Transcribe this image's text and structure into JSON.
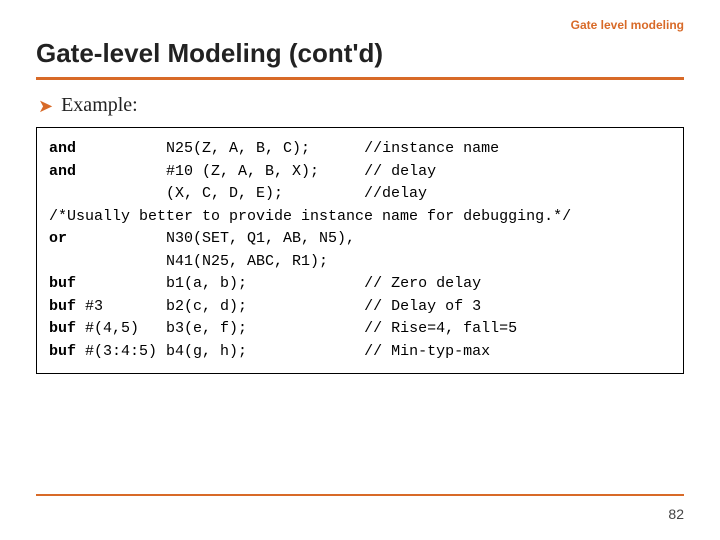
{
  "header_label": "Gate level modeling",
  "title": "Gate-level Modeling (cont'd)",
  "bullet": "Example:",
  "code": {
    "kw_and_1": "and",
    "l1_mid": "          N25(Z, A, B, C);      //instance name",
    "kw_and_2": "and",
    "l2_mid": "          #10 (Z, A, B, X);     // delay",
    "l3": "             (X, C, D, E);         //delay",
    "l4": "/*Usually better to provide instance name for debugging.*/",
    "kw_or": "or",
    "l5_mid": "           N30(SET, Q1, AB, N5),",
    "l6": "             N41(N25, ABC, R1);",
    "kw_buf_1": "buf",
    "l7_mid": "          b1(a, b);             // Zero delay",
    "kw_buf_2": "buf",
    "l8_mid": " #3       b2(c, d);             // Delay of 3",
    "kw_buf_3": "buf",
    "l9_mid": " #(4,5)   b3(e, f);             // Rise=4, fall=5",
    "kw_buf_4": "buf",
    "l10_mid": " #(3:4:5) b4(g, h);             // Min-typ-max"
  },
  "page_number": "82"
}
